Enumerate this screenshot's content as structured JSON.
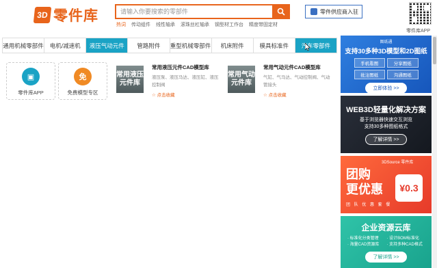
{
  "header": {
    "logo_badge": "3D",
    "logo_text": "零件库",
    "search_placeholder": "请输入你要搜索的零部件",
    "hot_label": "热词",
    "hot_terms": [
      "传动组件",
      "线性轴承",
      "滚珠丝杠轴承",
      "钢型材工作台",
      "精度带固定材"
    ],
    "supplier_button": "零件供应商入驻",
    "qr_label": "零件库APP",
    "accent_color": "#e8641b"
  },
  "nav": {
    "items": [
      "通用机械零部件",
      "电机/减速机",
      "液压气动元件",
      "管路附件",
      "重型机械零部件",
      "机床附件",
      "模具标准件",
      "汽车零部件"
    ],
    "active_index": 2,
    "active_color": "#1aa3c5"
  },
  "tiles": [
    {
      "label": "零件库APP",
      "icon": "app-icon",
      "color": "#1aa3c5"
    },
    {
      "label": "免费模型专区",
      "icon": "free-icon",
      "color": "#f08a24"
    }
  ],
  "cards": [
    {
      "thumb_text": "常用液压元件库",
      "title": "常用液压元件CAD模型库",
      "desc": "液压泵、液压马达、液压缸、液压控制阀",
      "fav": "点击收藏"
    },
    {
      "thumb_text": "常用气动元件库",
      "title": "常用气动元件CAD模型库",
      "desc": "气缸、气马达、气动控制阀、气动管接头",
      "fav": "点击收藏"
    }
  ],
  "banners": {
    "b1": {
      "small": "图纸通",
      "title": "支持30多种3D模型和2D图纸",
      "grid": [
        "手机看图",
        "分享图纸",
        "批注图纸",
        "沟通图纸"
      ],
      "button": "立即体验 >>"
    },
    "b2": {
      "title": "WEB3D轻量化解决方案",
      "sub1": "基于浏览器快速交互浏览",
      "sub2": "支持30多种图纸格式",
      "button": "了解详情 >>"
    },
    "b3": {
      "brand": "3DSource 零件库",
      "line1": "团购",
      "line2": "更优惠",
      "price": "¥0.3",
      "tags": "团 队 优 惠 套 餐"
    },
    "b4": {
      "title": "企业资源云库",
      "features": [
        "· 标准化分类管理",
        "· 设计BOM标准化",
        "· 海量CAD资源库",
        "· 支持多种CAD格式"
      ],
      "button": "了解详情 >>"
    }
  }
}
